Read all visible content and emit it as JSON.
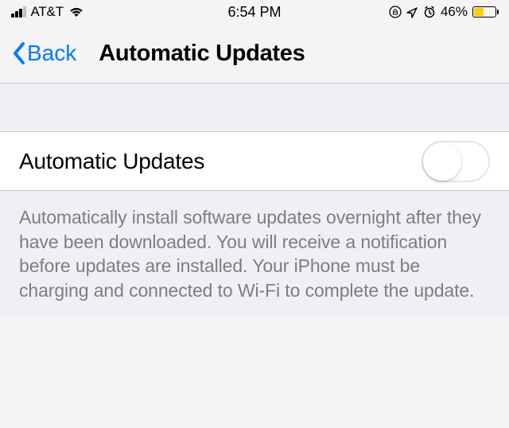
{
  "status": {
    "carrier": "AT&T",
    "time": "6:54 PM",
    "battery_pct_label": "46%",
    "battery_pct_value": 46
  },
  "nav": {
    "back_label": "Back",
    "title": "Automatic Updates"
  },
  "setting": {
    "label": "Automatic Updates",
    "toggle_on": false
  },
  "description": "Automatically install software updates overnight after they have been downloaded. You will receive a notification before updates are installed. Your iPhone must be charging and connected to Wi-Fi to complete the update."
}
